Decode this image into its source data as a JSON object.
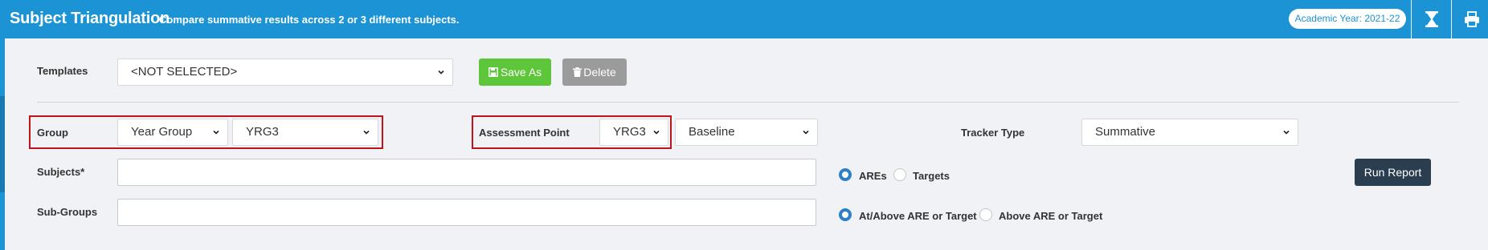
{
  "header": {
    "title": "Subject Triangulation",
    "subtitle": "Compare summative results across 2 or 3 different subjects.",
    "academic_year": "Academic Year: 2021-22",
    "icons": [
      "hourglass-icon",
      "print-icon"
    ]
  },
  "templates": {
    "label": "Templates",
    "selected": "<NOT SELECTED>",
    "save_as_label": "Save As",
    "delete_label": "Delete"
  },
  "group": {
    "label": "Group",
    "type_selected": "Year Group",
    "value_selected": "YRG3"
  },
  "assessment_point": {
    "label": "Assessment Point",
    "year_selected": "YRG3",
    "point_selected": "Baseline"
  },
  "tracker_type": {
    "label": "Tracker Type",
    "selected": "Summative"
  },
  "subjects": {
    "label": "Subjects*",
    "value": ""
  },
  "sub_groups": {
    "label": "Sub-Groups",
    "value": ""
  },
  "compare_mode": {
    "options": [
      {
        "label": "AREs",
        "checked": true
      },
      {
        "label": "Targets",
        "checked": false
      }
    ]
  },
  "threshold_mode": {
    "options": [
      {
        "label": "At/Above ARE or Target",
        "checked": true
      },
      {
        "label": "Above ARE or Target",
        "checked": false
      }
    ]
  },
  "run_report_label": "Run Report",
  "colors": {
    "header": "#1b93d4",
    "save_button": "#5ec63a",
    "delete_button": "#9b9b9b",
    "run_report_button": "#2b3e50",
    "highlight": "#c0141a",
    "radio_checked": "#2d7fc6"
  }
}
